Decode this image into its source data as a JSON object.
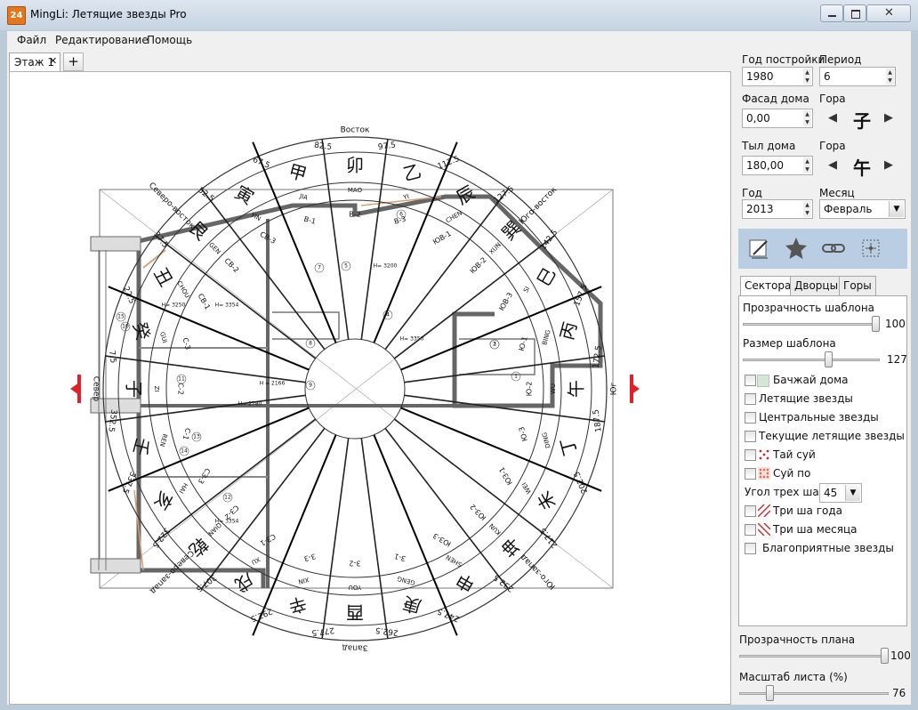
{
  "window": {
    "title": "MingLi: Летящие звезды Pro",
    "icon_text": "24"
  },
  "menu": [
    "Файл",
    "Редактирование",
    "Помощь"
  ],
  "doc_tabs": [
    {
      "label": "Этаж 1"
    }
  ],
  "compass": {
    "ring_labels": {
      "north": "Север",
      "east": "Восток",
      "south": "Юг",
      "west": "Запад",
      "ne": "Северо-восток",
      "se": "Юго-восток",
      "nw": "Северо-запад",
      "sw": "Юго-запад"
    },
    "degrees": [
      "82.5",
      "97.5",
      "67.5",
      "112.5",
      "52.5",
      "127.5",
      "37.5",
      "142.5",
      "22.5",
      "157.5",
      "7.5",
      "172.5",
      "352.5",
      "187.5",
      "337.5",
      "202.5",
      "322.5",
      "217.5",
      "307.5",
      "232.5",
      "292.5",
      "247.5",
      "277.5",
      "262.5"
    ],
    "mountains": [
      {
        "char": "甲",
        "pinyin": "JIA"
      },
      {
        "char": "卯",
        "pinyin": "MAO"
      },
      {
        "char": "乙",
        "pinyin": "YI"
      },
      {
        "char": "辰",
        "pinyin": "CHEN"
      },
      {
        "char": "巽",
        "pinyin": "XUN"
      },
      {
        "char": "巳",
        "pinyin": "SI"
      },
      {
        "char": "丙",
        "pinyin": "BING"
      },
      {
        "char": "午",
        "pinyin": "WU"
      },
      {
        "char": "丁",
        "pinyin": "DING"
      },
      {
        "char": "未",
        "pinyin": "WEI"
      },
      {
        "char": "坤",
        "pinyin": "KUN"
      },
      {
        "char": "申",
        "pinyin": "SHEN"
      },
      {
        "char": "庚",
        "pinyin": "GENG"
      },
      {
        "char": "酉",
        "pinyin": "YOU"
      },
      {
        "char": "辛",
        "pinyin": "XIN"
      },
      {
        "char": "戌",
        "pinyin": "XU"
      },
      {
        "char": "乾",
        "pinyin": "QIAN"
      },
      {
        "char": "亥",
        "pinyin": "HAI"
      },
      {
        "char": "壬",
        "pinyin": "REN"
      },
      {
        "char": "子",
        "pinyin": "ZI"
      },
      {
        "char": "癸",
        "pinyin": "GUI"
      },
      {
        "char": "丑",
        "pinyin": "CHOU"
      },
      {
        "char": "艮",
        "pinyin": "GEN"
      },
      {
        "char": "寅",
        "pinyin": "YIN"
      }
    ],
    "sectors": [
      "В-1",
      "В-2",
      "В-3",
      "ЮВ-1",
      "ЮВ-2",
      "ЮВ-3",
      "Ю-1",
      "Ю-2",
      "Ю-3",
      "ЮЗ-1",
      "ЮЗ-2",
      "ЮЗ-3",
      "З-1",
      "З-2",
      "З-3",
      "СЗ-1",
      "СЗ-2",
      "СЗ-3",
      "С-1",
      "С-2",
      "С-3",
      "СВ-1",
      "СВ-2",
      "СВ-3"
    ]
  },
  "plan": {
    "room_labels": [
      "H= 3354",
      "H= 3250",
      "H = 2166",
      "H= 2780",
      "H= 3200",
      "H= 3350",
      "H= 3354"
    ],
    "room_numbers": [
      "1",
      "2",
      "3",
      "4",
      "5",
      "6",
      "7",
      "8",
      "9",
      "10",
      "11",
      "12",
      "13",
      "14",
      "15"
    ]
  },
  "panel": {
    "build_year": {
      "label": "Год постройки",
      "value": "1980"
    },
    "period": {
      "label": "Период",
      "value": "6"
    },
    "facade": {
      "label": "Фасад дома",
      "value": "0,00"
    },
    "mountain1": {
      "label": "Гора",
      "value": "子"
    },
    "back": {
      "label": "Тыл дома",
      "value": "180,00"
    },
    "mountain2": {
      "label": "Гора",
      "value": "午"
    },
    "year": {
      "label": "Год",
      "value": "2013"
    },
    "month": {
      "label": "Месяц",
      "value": "Февраль"
    },
    "tabs": [
      "Сектора",
      "Дворцы",
      "Горы"
    ],
    "template_opacity": {
      "label": "Прозрачность шаблона",
      "value": 100
    },
    "template_size": {
      "label": "Размер шаблона",
      "value": 127
    },
    "checkboxes": [
      "Бачжай дома",
      "Летящие звезды",
      "Центральные звезды",
      "Текущие летящие звезды",
      "Тай суй",
      "Суй по"
    ],
    "three_sha_angle": {
      "label": "Угол трех ша:",
      "value": "45"
    },
    "checkboxes2": [
      "Три ша года",
      "Три ша месяца",
      "Благоприятные звезды"
    ],
    "plan_opacity": {
      "label": "Прозрачность плана",
      "value": 100
    },
    "sheet_scale": {
      "label": "Масштаб листа (%)",
      "value": 76
    }
  },
  "colors": {
    "accent_red": "#e0202a",
    "toolbox_bg": "#b9cde3",
    "bazhai_swatch": "#d6e6d6"
  }
}
